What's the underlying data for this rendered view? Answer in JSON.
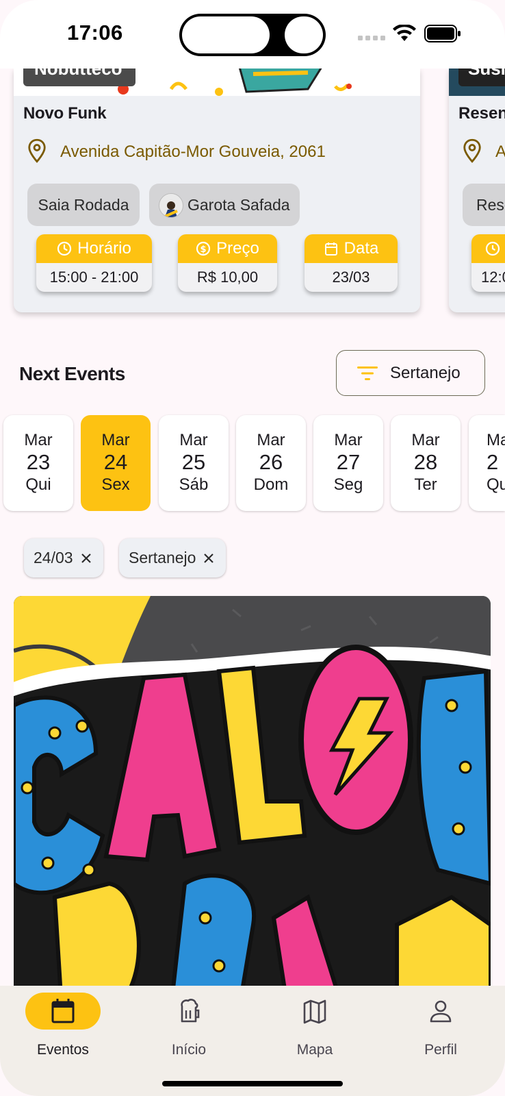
{
  "status_bar": {
    "time": "17:06"
  },
  "featured": [
    {
      "badge": "Nobutteco",
      "title": "Novo Funk",
      "address": "Avenida Capitão-Mor Gouveia, 2061",
      "chips": [
        "Saia Rodada",
        "Garota Safada"
      ],
      "info": [
        {
          "label": "Horário",
          "value": "15:00 - 21:00",
          "icon": "clock-icon"
        },
        {
          "label": "Preço",
          "value": "R$ 10,00",
          "icon": "dollar-circle-icon"
        },
        {
          "label": "Data",
          "value": "23/03",
          "icon": "calendar-icon"
        }
      ]
    },
    {
      "badge": "Susi",
      "title": "Resenh",
      "address": "A",
      "chip": "Rese",
      "time_partial": "12:0"
    }
  ],
  "next_events": {
    "title": "Next Events",
    "filter_label": "Sertanejo",
    "days": [
      {
        "month": "Mar",
        "day": "23",
        "weekday": "Qui"
      },
      {
        "month": "Mar",
        "day": "24",
        "weekday": "Sex"
      },
      {
        "month": "Mar",
        "day": "25",
        "weekday": "Sáb"
      },
      {
        "month": "Mar",
        "day": "26",
        "weekday": "Dom"
      },
      {
        "month": "Mar",
        "day": "27",
        "weekday": "Seg"
      },
      {
        "month": "Mar",
        "day": "28",
        "weekday": "Ter"
      },
      {
        "month": "Ma",
        "day": "2",
        "weekday": "Qu"
      }
    ],
    "selected_day_index": 1,
    "active_filters": [
      "24/03",
      "Sertanejo"
    ],
    "poster_text": "CALOURADA"
  },
  "nav": {
    "items": [
      {
        "label": "Eventos",
        "icon": "calendar-icon",
        "active": true
      },
      {
        "label": "Início",
        "icon": "beer-mug-icon",
        "active": false
      },
      {
        "label": "Mapa",
        "icon": "map-icon",
        "active": false
      },
      {
        "label": "Perfil",
        "icon": "person-icon",
        "active": false
      }
    ]
  },
  "colors": {
    "accent": "#FDC212",
    "address": "#7a5a00",
    "background": "#FEF7FA",
    "nav_bg": "#F2EEE9"
  }
}
